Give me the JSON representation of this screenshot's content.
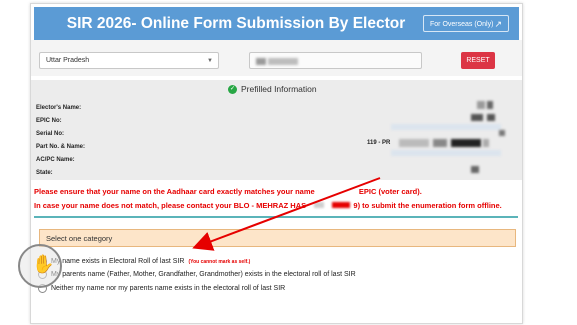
{
  "header": {
    "title": "SIR 2026- Online Form Submission By Elector",
    "overseas_label": "For Overseas (Only)",
    "overseas_icon": "external-link-icon"
  },
  "filters": {
    "state_value": "Uttar Pradesh",
    "reset_label": "RESET"
  },
  "prefilled": {
    "title": "Prefilled Information",
    "fields": [
      {
        "label": "Elector's Name:"
      },
      {
        "label": "EPIC No:"
      },
      {
        "label": "Serial No:"
      },
      {
        "label": "Part No. & Name:"
      },
      {
        "label": "AC/PC Name:"
      },
      {
        "label": "State:"
      }
    ],
    "part_value_prefix": "119 - PR"
  },
  "warning": {
    "line1_a": "Please ensure that your name on the Aadhaar card exactly matches your name",
    "line1_b": "EPIC (voter card).",
    "line2_a": "In case your name does not match, please contact your BLO - MEHRAZ HAS",
    "line2_b": "9) to submit the enumeration form offline."
  },
  "category": {
    "heading": "Select one category",
    "options": [
      {
        "label": "My name exists in Electoral Roll of last SIR",
        "note": "(You cannot mark as self.)"
      },
      {
        "label": "My parents name (Father, Mother, Grandfather, Grandmother) exists in the electoral roll of last SIR"
      },
      {
        "label": "Neither my name nor my parents name exists in the electoral roll of last SIR"
      }
    ]
  },
  "colors": {
    "header_bg": "#5b9bd5",
    "reset_bg": "#dc3545",
    "warning_text": "#e60000",
    "category_bg": "#fde5c9",
    "annotation_arrow": "#e60000"
  }
}
